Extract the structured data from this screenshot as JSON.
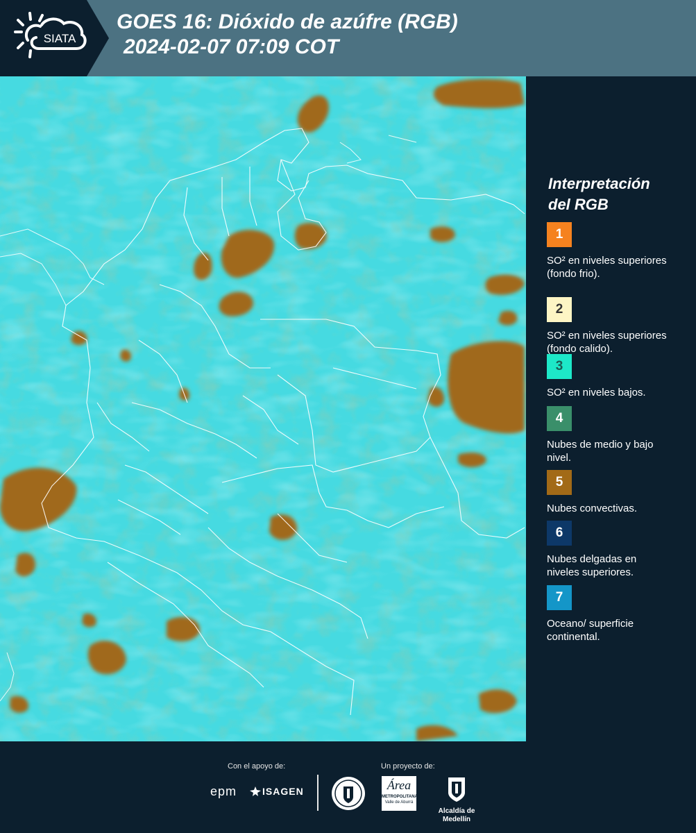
{
  "header": {
    "logo_text": "SIATA",
    "title_line1": "GOES 16: Dióxido de azúfre (RGB)",
    "title_line2": "2024-02-07 07:09 COT"
  },
  "legend": {
    "title_line1": "Interpretación",
    "title_line2": "del RGB",
    "items": [
      {
        "number": "1",
        "color": "#f5821f",
        "text_color": "#ffffff",
        "label": "SO² en niveles superiores (fondo frio)."
      },
      {
        "number": "2",
        "color": "#fdf5c4",
        "text_color": "#333333",
        "label": "SO² en niveles superiores (fondo calido)."
      },
      {
        "number": "3",
        "color": "#1de8c8",
        "text_color": "#1b5d55",
        "label": "SO² en niveles bajos."
      },
      {
        "number": "4",
        "color": "#3a8f6a",
        "text_color": "#ffffff",
        "label": "Nubes de medio y bajo nivel."
      },
      {
        "number": "5",
        "color": "#a26a17",
        "text_color": "#ffffff",
        "label": "Nubes convectivas."
      },
      {
        "number": "6",
        "color": "#0d3868",
        "text_color": "#ffffff",
        "label": "Nubes delgadas en niveles superiores."
      },
      {
        "number": "7",
        "color": "#1496c8",
        "text_color": "#ffffff",
        "label": "Oceano/ superficie continental."
      }
    ]
  },
  "footer": {
    "support_label": "Con el apoyo de:",
    "project_label": "Un proyecto de:",
    "epm_logo": "epm",
    "isagen_logo": "ISAGEN",
    "metro_logo": "Área",
    "metro_sub1": "METROPOLITANA",
    "metro_sub2": "Valle de Aburrá",
    "alcaldia_logo": "Alcaldía de Medellín"
  },
  "colors": {
    "header_bg": "#4c7282",
    "panel_bg": "#0c1f2e",
    "map_cyan": "#2ed8e0",
    "convective": "#a26a17",
    "border_lines": "#ffffff"
  },
  "icons": [
    "siata-sun-cloud-logo",
    "isagen-mark-icon",
    "medellin-seal-icon",
    "alcaldia-crest-icon"
  ]
}
